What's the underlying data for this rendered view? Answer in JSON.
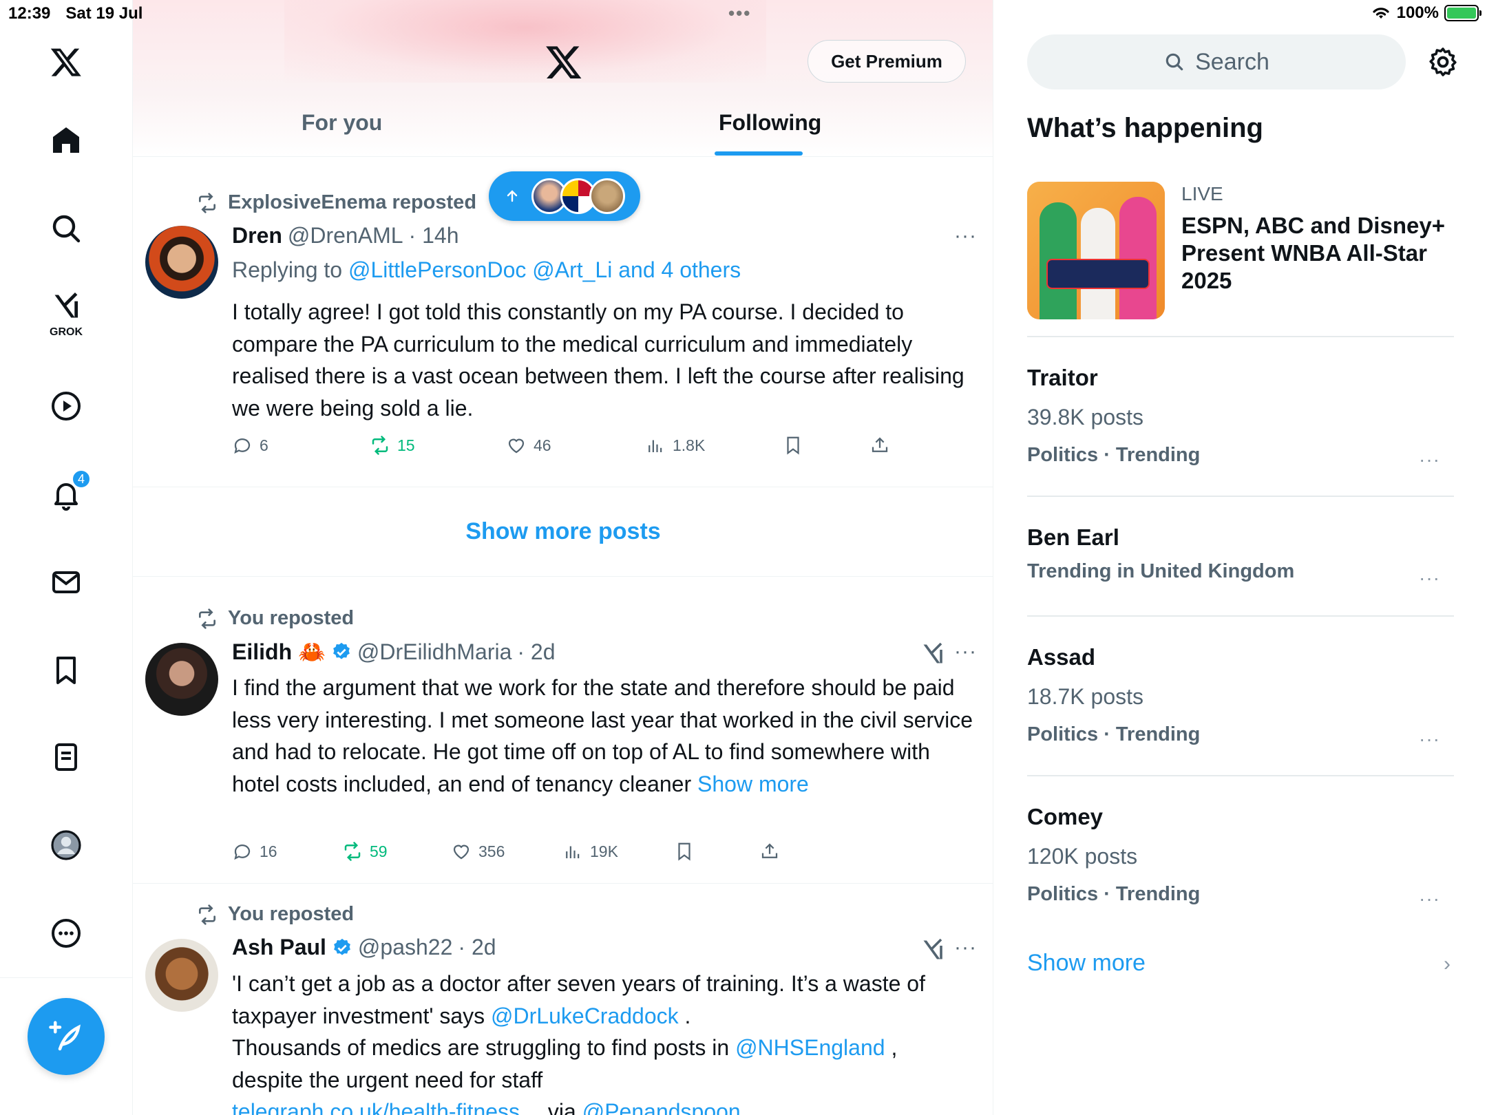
{
  "status_bar": {
    "time": "12:39",
    "date": "Sat 19 Jul",
    "battery": "100%"
  },
  "nav": {
    "grok_label": "GROK",
    "notifications_badge": "4"
  },
  "header": {
    "premium_button": "Get Premium",
    "tabs": [
      "For you",
      "Following"
    ],
    "active_tab": "Following"
  },
  "posts": [
    {
      "repost_label": "ExplosiveEnema reposted",
      "name": "Dren",
      "handle": "@DrenAML",
      "time": "· 14h",
      "reply_prefix": "Replying to ",
      "reply_targets": "@LittlePersonDoc @Art_Li and 4 others",
      "text": "I totally agree! I got told this constantly on my PA course. I decided to compare the PA curriculum to the medical curriculum and immediately realised there is a vast ocean between them. I left the course after realising we were being sold a lie.",
      "replies": "6",
      "reposts": "15",
      "likes": "46",
      "views": "1.8K"
    },
    {
      "repost_label": "You reposted",
      "name": "Eilidh 🦀",
      "handle": "@DrEilidhMaria",
      "time": "· 2d",
      "text": "I find the argument that we work for the state and therefore should be paid less very interesting. I met someone last year that worked in the civil service and had to relocate. He got time off on top of AL to find somewhere with hotel costs included, an end of tenancy cleaner",
      "show_more": "Show more",
      "replies": "16",
      "reposts": "59",
      "likes": "356",
      "views": "19K"
    },
    {
      "repost_label": "You reposted",
      "name": "Ash Paul",
      "handle": "@pash22",
      "time": "· 2d",
      "text_1": "'I can’t get a job as a doctor after seven years of training. It’s a waste of taxpayer investment' says ",
      "mention_1": "@DrLukeCraddock",
      "text_2": " .",
      "text_3": "Thousands of medics are struggling to find posts in ",
      "mention_2": "@NHSEngland",
      "text_4": " ,",
      "text_5": "despite the urgent need for staff",
      "link": "telegraph.co.uk/health-fitness…",
      "via": " via ",
      "mention_3": "@Penandspoon"
    }
  ],
  "show_more_posts": "Show more posts",
  "right": {
    "search_placeholder": "Search",
    "section_title": "What’s happening",
    "live": {
      "tag": "LIVE",
      "title": "ESPN, ABC and Disney+ Present WNBA All-Star 2025"
    },
    "trends": [
      {
        "title": "Traitor",
        "posts": "39.8K posts",
        "meta": "Politics · Trending"
      },
      {
        "title": "Ben Earl",
        "posts": "",
        "meta": "Trending in United Kingdom"
      },
      {
        "title": "Assad",
        "posts": "18.7K posts",
        "meta": "Politics · Trending"
      },
      {
        "title": "Comey",
        "posts": "120K posts",
        "meta": "Politics · Trending"
      }
    ],
    "show_more": "Show more"
  },
  "colors": {
    "accent": "#1d9bf0",
    "repost_green": "#00ba7c",
    "muted": "#536471"
  }
}
